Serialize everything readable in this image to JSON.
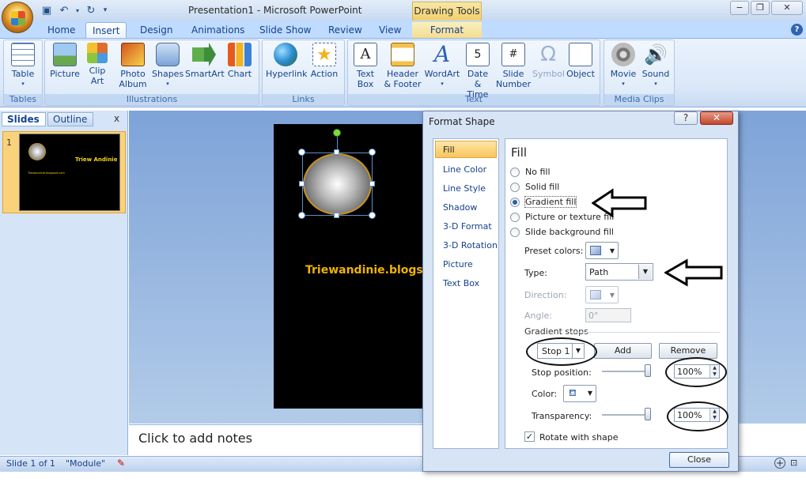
{
  "titlebar": {
    "title": "Presentation1 - Microsoft PowerPoint",
    "context_tab": "Drawing Tools"
  },
  "tabs": [
    "Home",
    "Insert",
    "Design",
    "Animations",
    "Slide Show",
    "Review",
    "View",
    "Format"
  ],
  "active_tab": "Insert",
  "ribbon": {
    "groups": {
      "tables": "Tables",
      "illustrations": "Illustrations",
      "links": "Links",
      "text": "Text",
      "media": "Media Clips"
    },
    "buttons": {
      "table": "Table",
      "picture": "Picture",
      "clip_art_1": "Clip",
      "clip_art_2": "Art",
      "photo_album_1": "Photo",
      "photo_album_2": "Album",
      "shapes": "Shapes",
      "smartart": "SmartArt",
      "chart": "Chart",
      "hyperlink": "Hyperlink",
      "action": "Action",
      "text_box_1": "Text",
      "text_box_2": "Box",
      "header_footer_1": "Header",
      "header_footer_2": "& Footer",
      "wordart": "WordArt",
      "date_time_1": "Date",
      "date_time_2": "& Time",
      "slide_number_1": "Slide",
      "slide_number_2": "Number",
      "symbol": "Symbol",
      "object": "Object",
      "movie": "Movie",
      "sound": "Sound"
    }
  },
  "left_panel": {
    "tab_slides": "Slides",
    "tab_outline": "Outline",
    "close": "x",
    "thumb_number": "1",
    "thumb_title": "Triew Andinie",
    "thumb_url": "Triewandinie.blogspot.com"
  },
  "slide": {
    "text": "Triewandinie.blogspot.com"
  },
  "notes": {
    "placeholder": "Click to add notes"
  },
  "status": {
    "slide": "Slide 1 of 1",
    "theme": "\"Module\""
  },
  "dialog": {
    "title": "Format Shape",
    "help": "?",
    "nav": [
      "Fill",
      "Line Color",
      "Line Style",
      "Shadow",
      "3-D Format",
      "3-D Rotation",
      "Picture",
      "Text Box"
    ],
    "heading": "Fill",
    "options": [
      "No fill",
      "Solid fill",
      "Gradient fill",
      "Picture or texture fill",
      "Slide background fill"
    ],
    "selected_option": "Gradient fill",
    "preset_colors_label": "Preset colors:",
    "type_label": "Type:",
    "type_value": "Path",
    "direction_label": "Direction:",
    "angle_label": "Angle:",
    "angle_value": "0°",
    "gradient_stops_label": "Gradient stops",
    "stop_value": "Stop 1",
    "add_label": "Add",
    "remove_label": "Remove",
    "stop_position_label": "Stop position:",
    "stop_position_value": "100%",
    "color_label": "Color:",
    "transparency_label": "Transparency:",
    "transparency_value": "100%",
    "rotate_label": "Rotate with shape",
    "close_label": "Close"
  },
  "colors": {
    "accent_orange": "#f9c55c",
    "slide_text": "#f0b400",
    "ribbon_blue": "#dbe8f8"
  }
}
